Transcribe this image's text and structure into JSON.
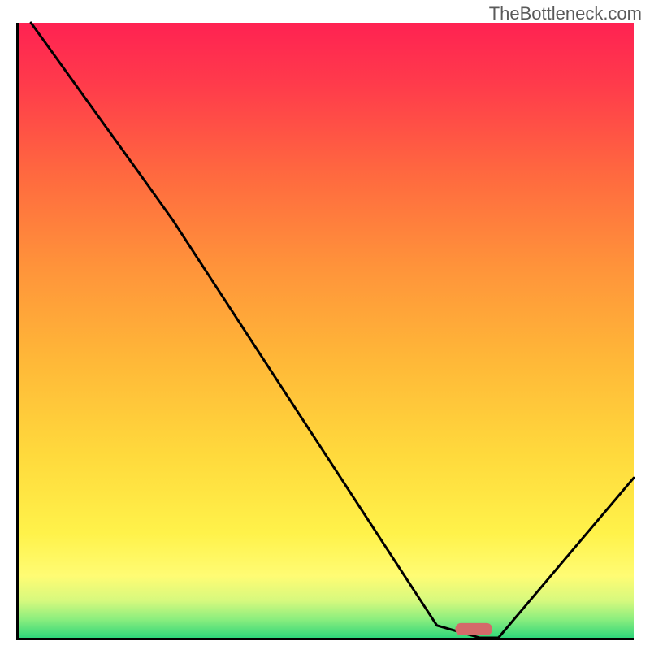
{
  "watermark": "TheBottleneck.com",
  "chart_data": {
    "type": "line",
    "title": "",
    "xlabel": "",
    "ylabel": "",
    "xlim_pct": [
      0,
      100
    ],
    "ylim_pct": [
      0,
      100
    ],
    "series": [
      {
        "name": "bottleneck-curve",
        "x_pct": [
          2,
          20,
          25,
          68,
          75,
          78,
          100
        ],
        "y_pct": [
          100,
          75,
          68,
          2,
          0,
          0,
          26
        ]
      }
    ],
    "marker": {
      "name": "optimal-range",
      "x_pct": 71,
      "y_pct": 0,
      "width_pct": 6,
      "height_pct": 2,
      "color": "#d46a6a"
    },
    "gradient_stops": [
      {
        "pos": 0,
        "color": "#ff2252"
      },
      {
        "pos": 10,
        "color": "#ff3b4b"
      },
      {
        "pos": 25,
        "color": "#ff6a3f"
      },
      {
        "pos": 40,
        "color": "#ff943a"
      },
      {
        "pos": 55,
        "color": "#ffb838"
      },
      {
        "pos": 70,
        "color": "#ffd93c"
      },
      {
        "pos": 83,
        "color": "#fff24a"
      },
      {
        "pos": 90,
        "color": "#fffc74"
      },
      {
        "pos": 94,
        "color": "#d6f97e"
      },
      {
        "pos": 97,
        "color": "#8bee7e"
      },
      {
        "pos": 100,
        "color": "#2fd67a"
      }
    ]
  }
}
